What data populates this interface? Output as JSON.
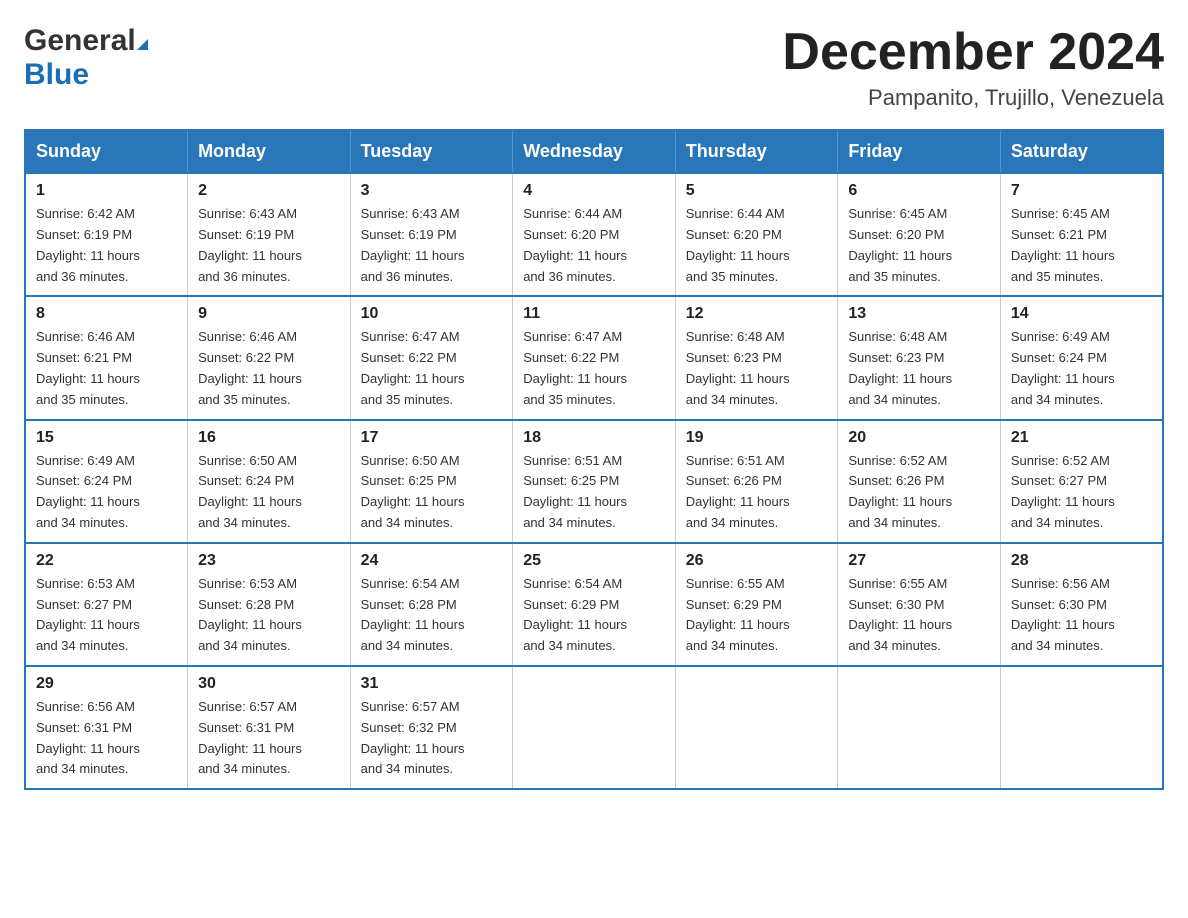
{
  "header": {
    "logo_general": "General",
    "logo_blue": "Blue",
    "month_title": "December 2024",
    "location": "Pampanito, Trujillo, Venezuela"
  },
  "weekdays": [
    "Sunday",
    "Monday",
    "Tuesday",
    "Wednesday",
    "Thursday",
    "Friday",
    "Saturday"
  ],
  "weeks": [
    [
      {
        "day": "1",
        "sunrise": "6:42 AM",
        "sunset": "6:19 PM",
        "daylight": "11 hours and 36 minutes."
      },
      {
        "day": "2",
        "sunrise": "6:43 AM",
        "sunset": "6:19 PM",
        "daylight": "11 hours and 36 minutes."
      },
      {
        "day": "3",
        "sunrise": "6:43 AM",
        "sunset": "6:19 PM",
        "daylight": "11 hours and 36 minutes."
      },
      {
        "day": "4",
        "sunrise": "6:44 AM",
        "sunset": "6:20 PM",
        "daylight": "11 hours and 36 minutes."
      },
      {
        "day": "5",
        "sunrise": "6:44 AM",
        "sunset": "6:20 PM",
        "daylight": "11 hours and 35 minutes."
      },
      {
        "day": "6",
        "sunrise": "6:45 AM",
        "sunset": "6:20 PM",
        "daylight": "11 hours and 35 minutes."
      },
      {
        "day": "7",
        "sunrise": "6:45 AM",
        "sunset": "6:21 PM",
        "daylight": "11 hours and 35 minutes."
      }
    ],
    [
      {
        "day": "8",
        "sunrise": "6:46 AM",
        "sunset": "6:21 PM",
        "daylight": "11 hours and 35 minutes."
      },
      {
        "day": "9",
        "sunrise": "6:46 AM",
        "sunset": "6:22 PM",
        "daylight": "11 hours and 35 minutes."
      },
      {
        "day": "10",
        "sunrise": "6:47 AM",
        "sunset": "6:22 PM",
        "daylight": "11 hours and 35 minutes."
      },
      {
        "day": "11",
        "sunrise": "6:47 AM",
        "sunset": "6:22 PM",
        "daylight": "11 hours and 35 minutes."
      },
      {
        "day": "12",
        "sunrise": "6:48 AM",
        "sunset": "6:23 PM",
        "daylight": "11 hours and 34 minutes."
      },
      {
        "day": "13",
        "sunrise": "6:48 AM",
        "sunset": "6:23 PM",
        "daylight": "11 hours and 34 minutes."
      },
      {
        "day": "14",
        "sunrise": "6:49 AM",
        "sunset": "6:24 PM",
        "daylight": "11 hours and 34 minutes."
      }
    ],
    [
      {
        "day": "15",
        "sunrise": "6:49 AM",
        "sunset": "6:24 PM",
        "daylight": "11 hours and 34 minutes."
      },
      {
        "day": "16",
        "sunrise": "6:50 AM",
        "sunset": "6:24 PM",
        "daylight": "11 hours and 34 minutes."
      },
      {
        "day": "17",
        "sunrise": "6:50 AM",
        "sunset": "6:25 PM",
        "daylight": "11 hours and 34 minutes."
      },
      {
        "day": "18",
        "sunrise": "6:51 AM",
        "sunset": "6:25 PM",
        "daylight": "11 hours and 34 minutes."
      },
      {
        "day": "19",
        "sunrise": "6:51 AM",
        "sunset": "6:26 PM",
        "daylight": "11 hours and 34 minutes."
      },
      {
        "day": "20",
        "sunrise": "6:52 AM",
        "sunset": "6:26 PM",
        "daylight": "11 hours and 34 minutes."
      },
      {
        "day": "21",
        "sunrise": "6:52 AM",
        "sunset": "6:27 PM",
        "daylight": "11 hours and 34 minutes."
      }
    ],
    [
      {
        "day": "22",
        "sunrise": "6:53 AM",
        "sunset": "6:27 PM",
        "daylight": "11 hours and 34 minutes."
      },
      {
        "day": "23",
        "sunrise": "6:53 AM",
        "sunset": "6:28 PM",
        "daylight": "11 hours and 34 minutes."
      },
      {
        "day": "24",
        "sunrise": "6:54 AM",
        "sunset": "6:28 PM",
        "daylight": "11 hours and 34 minutes."
      },
      {
        "day": "25",
        "sunrise": "6:54 AM",
        "sunset": "6:29 PM",
        "daylight": "11 hours and 34 minutes."
      },
      {
        "day": "26",
        "sunrise": "6:55 AM",
        "sunset": "6:29 PM",
        "daylight": "11 hours and 34 minutes."
      },
      {
        "day": "27",
        "sunrise": "6:55 AM",
        "sunset": "6:30 PM",
        "daylight": "11 hours and 34 minutes."
      },
      {
        "day": "28",
        "sunrise": "6:56 AM",
        "sunset": "6:30 PM",
        "daylight": "11 hours and 34 minutes."
      }
    ],
    [
      {
        "day": "29",
        "sunrise": "6:56 AM",
        "sunset": "6:31 PM",
        "daylight": "11 hours and 34 minutes."
      },
      {
        "day": "30",
        "sunrise": "6:57 AM",
        "sunset": "6:31 PM",
        "daylight": "11 hours and 34 minutes."
      },
      {
        "day": "31",
        "sunrise": "6:57 AM",
        "sunset": "6:32 PM",
        "daylight": "11 hours and 34 minutes."
      },
      null,
      null,
      null,
      null
    ]
  ],
  "labels": {
    "sunrise": "Sunrise: ",
    "sunset": "Sunset: ",
    "daylight": "Daylight: "
  }
}
